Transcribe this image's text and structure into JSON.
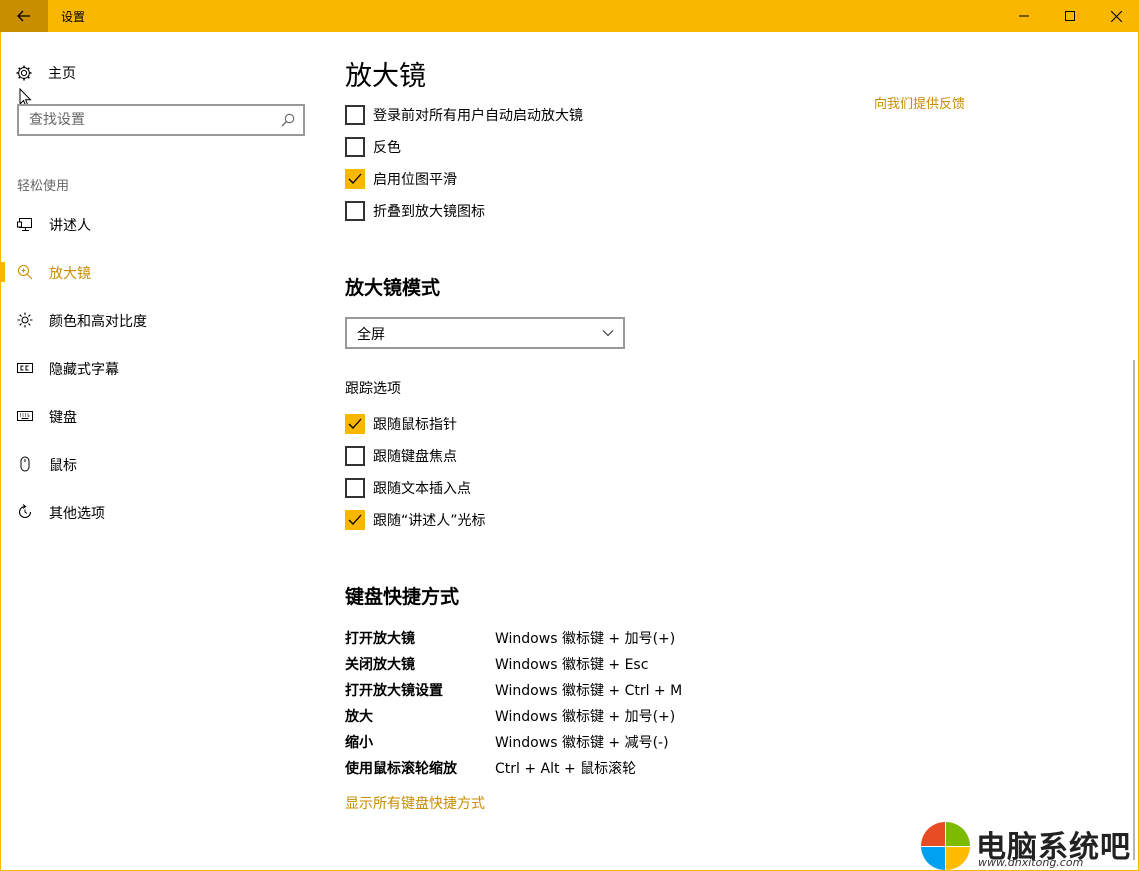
{
  "window": {
    "title": "设置",
    "accent_color": "#f9b700",
    "accent_dark": "#c98d00",
    "controls": [
      "minimize-icon",
      "maximize-icon",
      "close-icon"
    ]
  },
  "sidebar": {
    "home_label": "主页",
    "search_placeholder": "查找设置",
    "section_label": "轻松使用",
    "items": [
      {
        "label": "讲述人",
        "icon": "narrator-icon"
      },
      {
        "label": "放大镜",
        "icon": "magnifier-icon",
        "active": true
      },
      {
        "label": "颜色和高对比度",
        "icon": "brightness-icon"
      },
      {
        "label": "隐藏式字幕",
        "icon": "closed-caption-icon"
      },
      {
        "label": "键盘",
        "icon": "keyboard-icon"
      },
      {
        "label": "鼠标",
        "icon": "mouse-icon"
      },
      {
        "label": "其他选项",
        "icon": "refresh-icon"
      }
    ]
  },
  "main": {
    "title": "放大镜",
    "feedback_link": "向我们提供反馈",
    "options": [
      {
        "label": "登录前对所有用户自动启动放大镜",
        "checked": false
      },
      {
        "label": "反色",
        "checked": false
      },
      {
        "label": "启用位图平滑",
        "checked": true
      },
      {
        "label": "折叠到放大镜图标",
        "checked": false
      }
    ],
    "mode_heading": "放大镜模式",
    "mode_value": "全屏",
    "tracking_label": "跟踪选项",
    "tracking": [
      {
        "label": "跟随鼠标指针",
        "checked": true
      },
      {
        "label": "跟随键盘焦点",
        "checked": false
      },
      {
        "label": "跟随文本插入点",
        "checked": false
      },
      {
        "label": "跟随“讲述人”光标",
        "checked": true
      }
    ],
    "shortcuts_heading": "键盘快捷方式",
    "shortcuts": [
      {
        "action": "打开放大镜",
        "keys": "Windows 徽标键 + 加号(+)"
      },
      {
        "action": "关闭放大镜",
        "keys": "Windows 徽标键 + Esc"
      },
      {
        "action": "打开放大镜设置",
        "keys": "Windows 徽标键 + Ctrl + M"
      },
      {
        "action": "放大",
        "keys": "Windows 徽标键 + 加号(+)"
      },
      {
        "action": "缩小",
        "keys": "Windows 徽标键 + 减号(-)"
      },
      {
        "action": "使用鼠标滚轮缩放",
        "keys": "Ctrl + Alt + 鼠标滚轮"
      }
    ],
    "show_all_link": "显示所有键盘快捷方式"
  },
  "watermark": {
    "brand": "电脑系统吧",
    "url": "www.dnxitong.com"
  }
}
